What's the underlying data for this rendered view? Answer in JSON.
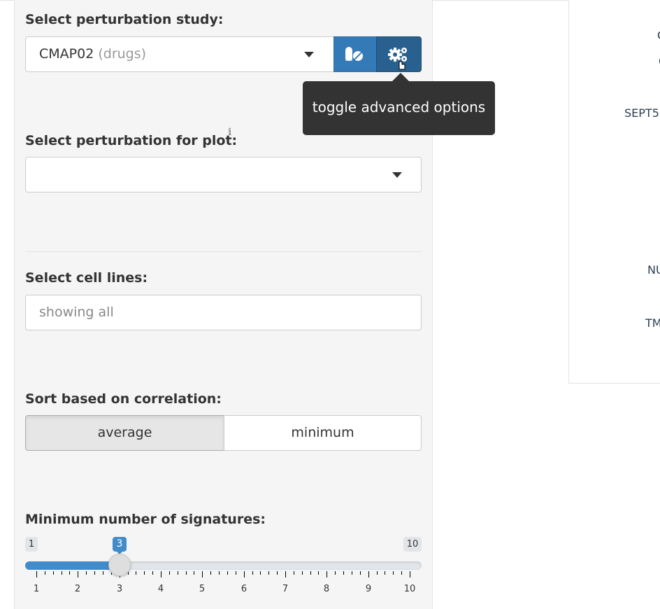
{
  "study": {
    "label": "Select perturbation study:",
    "selected_value": "CMAP02",
    "selected_suffix": "(drugs)",
    "drugs_button_icon": "pills-icon",
    "advanced_button_icon": "cogs-icon",
    "tooltip": "toggle advanced options"
  },
  "perturbation": {
    "label": "Select perturbation for plot:",
    "info_mark": "i",
    "selected_value": ""
  },
  "cell_lines": {
    "label": "Select cell lines:",
    "placeholder": "showing all"
  },
  "sort": {
    "label": "Sort based on correlation:",
    "options": [
      "average",
      "minimum"
    ],
    "selected": "average"
  },
  "signatures": {
    "label": "Minimum number of signatures:",
    "min": 1,
    "max": 10,
    "value": 3,
    "min_label": "1",
    "max_label": "10",
    "value_label": "3",
    "tick_labels": [
      "1",
      "2",
      "3",
      "4",
      "5",
      "6",
      "7",
      "8",
      "9",
      "10"
    ]
  },
  "right_panel": {
    "labels": [
      "C",
      "C",
      "SEPT5",
      "NU",
      "TM"
    ]
  },
  "colors": {
    "primary": "#337ab7",
    "primary_dark": "#286090",
    "slider": "#428bca",
    "tooltip_bg": "#333333",
    "sidebar_bg": "#f5f5f5"
  }
}
